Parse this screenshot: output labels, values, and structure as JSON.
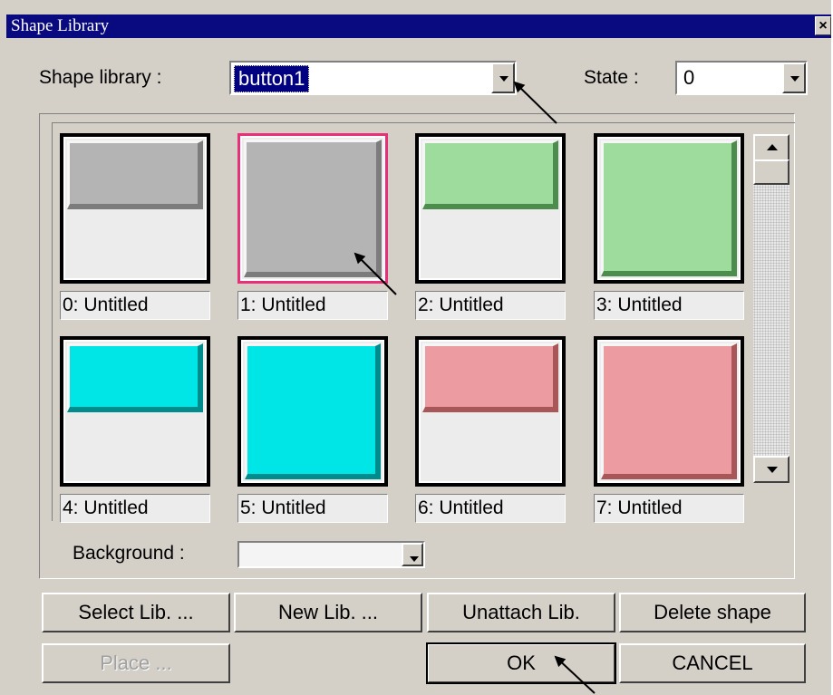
{
  "window": {
    "title": "Shape Library",
    "close_glyph": "×"
  },
  "shape_library": {
    "label": "Shape library :",
    "value": "button1"
  },
  "state": {
    "label": "State :",
    "value": "0"
  },
  "shapes": [
    {
      "caption": "0: Untitled",
      "style": "half",
      "face": "#b4b4b4",
      "shadow": "#7c7c7c"
    },
    {
      "caption": "1: Untitled",
      "style": "full",
      "face": "#b4b4b4",
      "shadow": "#7c7c7c",
      "selected": true
    },
    {
      "caption": "2: Untitled",
      "style": "half",
      "face": "#9edc9e",
      "shadow": "#4c8c4c"
    },
    {
      "caption": "3: Untitled",
      "style": "full",
      "face": "#9edc9e",
      "shadow": "#4c8c4c"
    },
    {
      "caption": "4: Untitled",
      "style": "half",
      "face": "#00e6e6",
      "shadow": "#008c8c"
    },
    {
      "caption": "5: Untitled",
      "style": "full",
      "face": "#00e6e6",
      "shadow": "#008c8c"
    },
    {
      "caption": "6: Untitled",
      "style": "half",
      "face": "#ec9ca0",
      "shadow": "#a85658"
    },
    {
      "caption": "7: Untitled",
      "style": "full",
      "face": "#ec9ca0",
      "shadow": "#a85658"
    }
  ],
  "background": {
    "label": "Background :",
    "value": ""
  },
  "buttons": {
    "select_lib": "Select Lib. ...",
    "new_lib": "New Lib. ...",
    "unattach_lib": "Unattach Lib.",
    "delete_shape": "Delete shape",
    "place": "Place ...",
    "ok": "OK",
    "cancel": "CANCEL"
  },
  "colors": {
    "title_bar": "#0a0a80",
    "dialog_face": "#d4d0c8",
    "selection_border": "#e8307a"
  }
}
